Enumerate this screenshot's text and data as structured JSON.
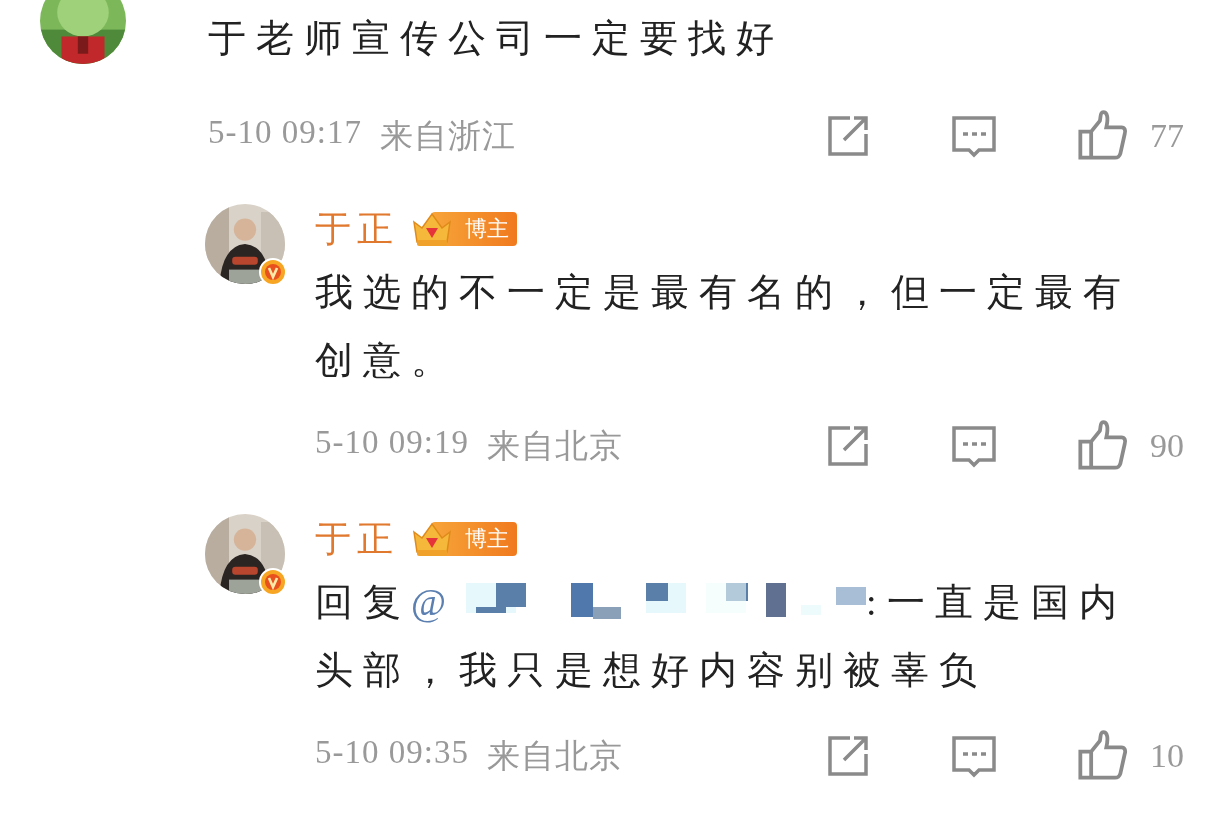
{
  "comments": [
    {
      "avatar": {
        "kind": "picture"
      },
      "text": "于老师宣传公司一定要找好",
      "time": "5-10 09:17",
      "location": "来自浙江",
      "likes": "77",
      "replies": [
        {
          "avatar": {
            "kind": "picture"
          },
          "author": "于正",
          "badge": "博主",
          "verified": true,
          "segments": [
            {
              "kind": "text",
              "text": "我选的不一定是最有名的，但一定最有创意。"
            }
          ],
          "time": "5-10 09:19",
          "location": "来自北京",
          "likes": "90"
        },
        {
          "avatar": {
            "kind": "picture"
          },
          "author": "于正",
          "badge": "博主",
          "verified": true,
          "segments": [
            {
              "kind": "text",
              "text": "回复"
            },
            {
              "kind": "mention",
              "text": "@"
            },
            {
              "kind": "redacted"
            },
            {
              "kind": "text",
              "text": ":一直是国内头部，我只是想好内容别被辜负"
            }
          ],
          "time": "5-10 09:35",
          "location": "来自北京",
          "likes": "10"
        }
      ]
    }
  ]
}
